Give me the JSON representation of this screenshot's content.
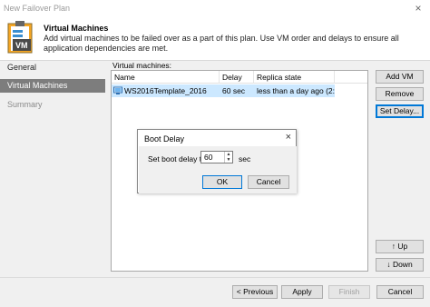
{
  "window": {
    "title": "New Failover Plan"
  },
  "header": {
    "title": "Virtual Machines",
    "description": "Add virtual machines to be failed over as a part of this plan. Use VM order and delays to ensure all application dependencies are met."
  },
  "sidebar": {
    "items": [
      {
        "label": "General"
      },
      {
        "label": "Virtual Machines"
      },
      {
        "label": "Summary"
      }
    ]
  },
  "vm_list": {
    "label": "Virtual machines:",
    "columns": [
      "Name",
      "Delay",
      "Replica state"
    ],
    "rows": [
      {
        "name": "WS2016Template_2016",
        "delay": "60 sec",
        "state": "less than a day ago (2:2..."
      }
    ]
  },
  "side_buttons": {
    "add": "Add VM",
    "remove": "Remove",
    "set_delay": "Set Delay...",
    "up": "Up",
    "down": "Down"
  },
  "footer": {
    "previous": "< Previous",
    "apply": "Apply",
    "finish": "Finish",
    "cancel": "Cancel"
  },
  "dialog": {
    "title": "Boot Delay",
    "label": "Set boot delay to:",
    "value": "60",
    "unit": "sec",
    "ok": "OK",
    "cancel": "Cancel"
  },
  "icons": {
    "close": "×",
    "arrow_up": "↑",
    "arrow_down": "↓"
  }
}
